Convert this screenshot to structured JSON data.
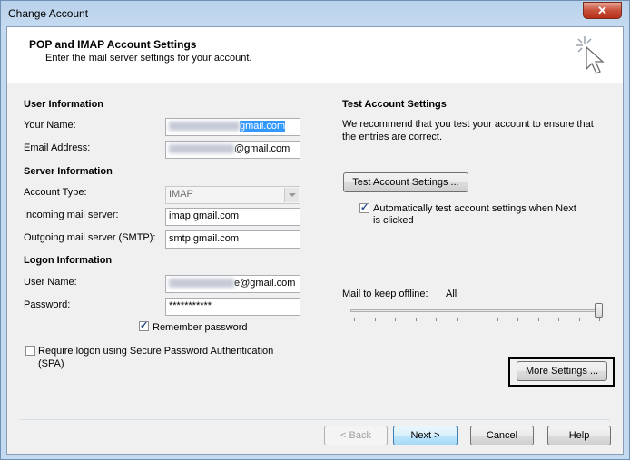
{
  "window": {
    "title": "Change Account",
    "close_label": "✕"
  },
  "header": {
    "title": "POP and IMAP Account Settings",
    "subtitle": "Enter the mail server settings for your account."
  },
  "user_info": {
    "heading": "User Information",
    "name_label": "Your Name:",
    "name_value_suffix": "gmail.com",
    "email_label": "Email Address:",
    "email_value_suffix": "@gmail.com"
  },
  "server_info": {
    "heading": "Server Information",
    "account_type_label": "Account Type:",
    "account_type_value": "IMAP",
    "incoming_label": "Incoming mail server:",
    "incoming_value": "imap.gmail.com",
    "outgoing_label": "Outgoing mail server (SMTP):",
    "outgoing_value": "smtp.gmail.com"
  },
  "logon_info": {
    "heading": "Logon Information",
    "username_label": "User Name:",
    "username_value_suffix": "e@gmail.com",
    "password_label": "Password:",
    "password_value": "***********",
    "remember_label": "Remember password",
    "remember_checked": true,
    "spa_label_line1": "Require logon using Secure Password Authentication",
    "spa_label_line2": "(SPA)",
    "spa_checked": false
  },
  "test_settings": {
    "heading": "Test Account Settings",
    "desc_line1": "We recommend that you test your account to ensure that",
    "desc_line2": "the entries are correct.",
    "test_button": "Test Account Settings ...",
    "auto_test_line1": "Automatically test account settings when Next",
    "auto_test_line2": "is clicked",
    "auto_test_checked": true
  },
  "offline": {
    "label": "Mail to keep offline:",
    "value": "All",
    "slider_position": 1.0
  },
  "more_settings_button": "More Settings ...",
  "footer": {
    "back": "< Back",
    "next": "Next >",
    "cancel": "Cancel",
    "help": "Help"
  },
  "colors": {
    "selection": "#3399ff",
    "accent_button": "#3c7fb1"
  }
}
